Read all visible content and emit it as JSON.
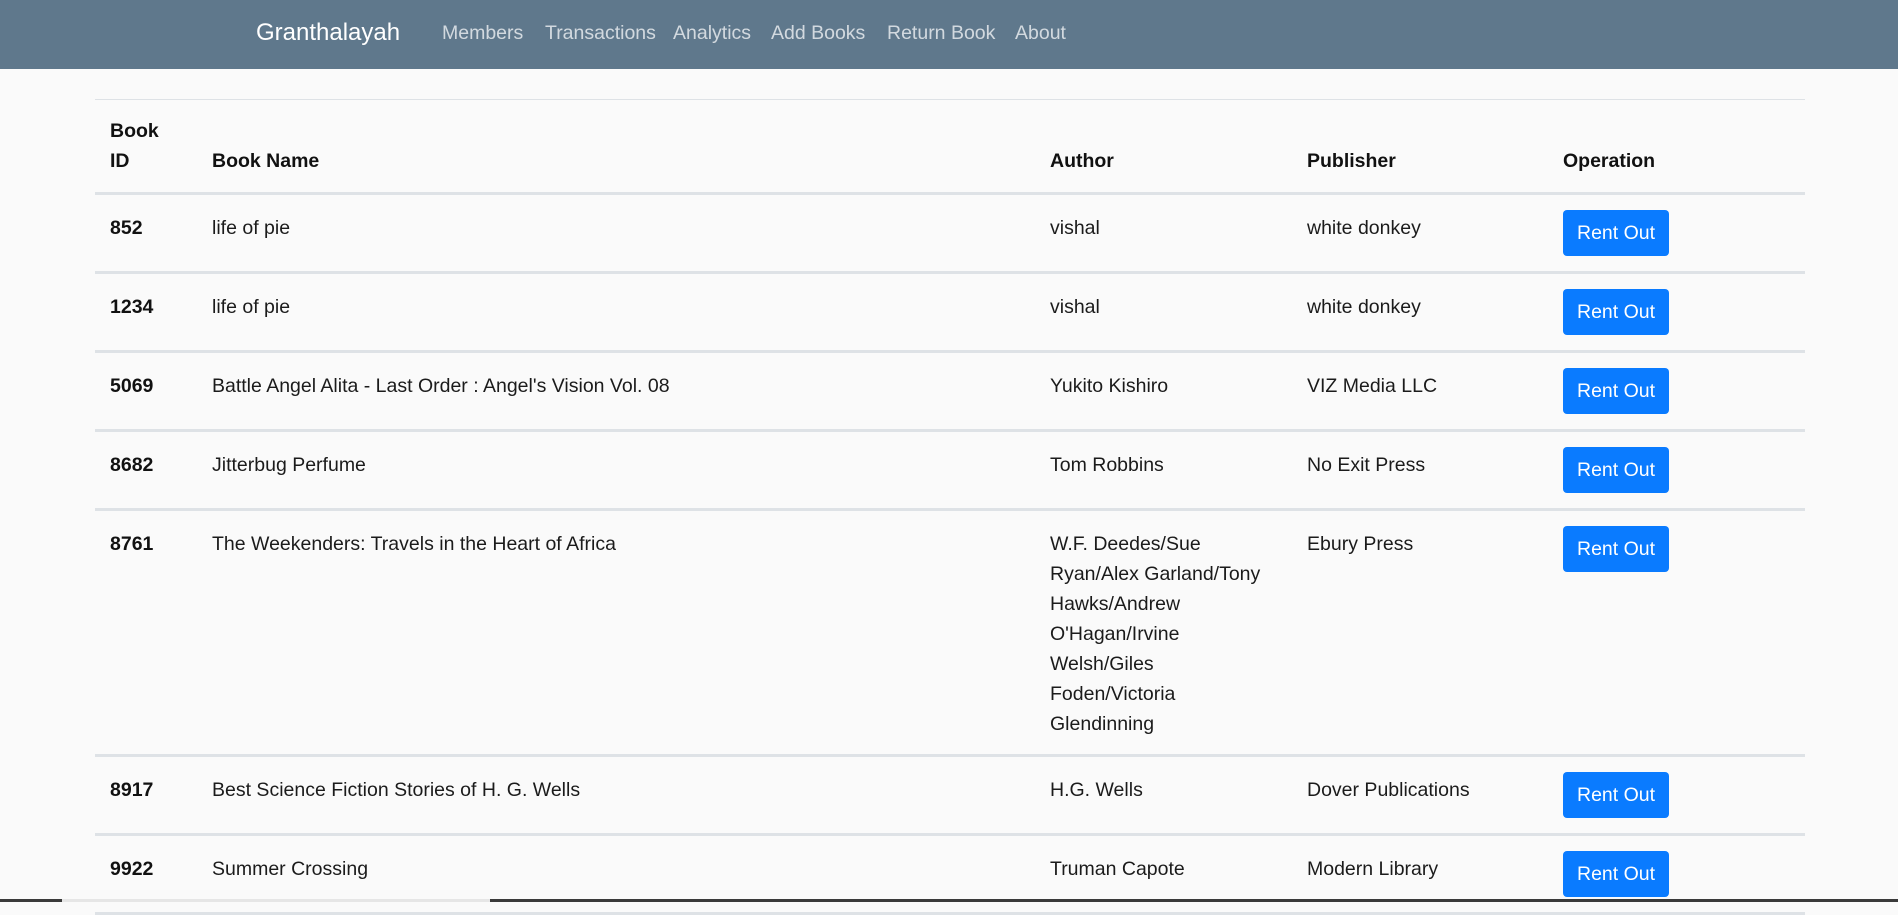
{
  "navbar": {
    "brand": "Granthalayah",
    "links": [
      "Members",
      "Transactions",
      "Analytics",
      "Add Books",
      "Return Book",
      "About"
    ]
  },
  "table": {
    "headers": {
      "book_id": "Book ID",
      "book_name": "Book Name",
      "author": "Author",
      "publisher": "Publisher",
      "operation": "Operation"
    },
    "rows": [
      {
        "id": "852",
        "name": "life of pie",
        "author": "vishal",
        "publisher": "white donkey",
        "action": "Rent Out"
      },
      {
        "id": "1234",
        "name": "life of pie",
        "author": "vishal",
        "publisher": "white donkey",
        "action": "Rent Out"
      },
      {
        "id": "5069",
        "name": "Battle Angel Alita - Last Order : Angel's Vision Vol. 08",
        "author": "Yukito Kishiro",
        "publisher": "VIZ Media LLC",
        "action": "Rent Out"
      },
      {
        "id": "8682",
        "name": "Jitterbug Perfume",
        "author": "Tom Robbins",
        "publisher": "No Exit Press",
        "action": "Rent Out"
      },
      {
        "id": "8761",
        "name": "The Weekenders: Travels in the Heart of Africa",
        "author": "W.F. Deedes/Sue Ryan/Alex Garland/Tony Hawks/Andrew O'Hagan/Irvine Welsh/Giles Foden/Victoria Glendinning",
        "publisher": "Ebury Press",
        "action": "Rent Out"
      },
      {
        "id": "8917",
        "name": "Best Science Fiction Stories of H. G. Wells",
        "author": "H.G. Wells",
        "publisher": "Dover Publications",
        "action": "Rent Out"
      },
      {
        "id": "9922",
        "name": "Summer Crossing",
        "author": "Truman Capote",
        "publisher": "Modern Library",
        "action": "Rent Out"
      }
    ]
  },
  "colors": {
    "navbar_bg": "#5f788c",
    "button_bg": "#0a7bff",
    "page_bg": "#fafafa"
  }
}
